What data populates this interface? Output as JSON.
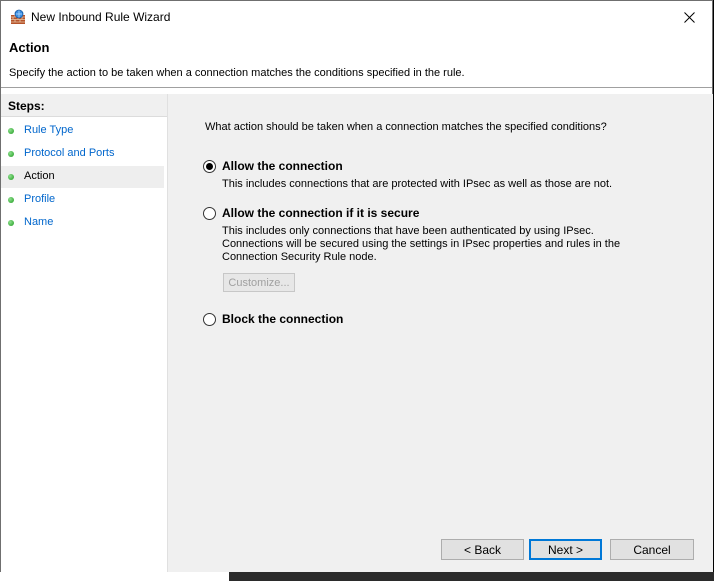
{
  "window": {
    "title": "New Inbound Rule Wizard"
  },
  "header": {
    "title": "Action",
    "description": "Specify the action to be taken when a connection matches the conditions specified in the rule."
  },
  "steps": {
    "title": "Steps:",
    "items": [
      {
        "label": "Rule Type",
        "current": false
      },
      {
        "label": "Protocol and Ports",
        "current": false
      },
      {
        "label": "Action",
        "current": true
      },
      {
        "label": "Profile",
        "current": false
      },
      {
        "label": "Name",
        "current": false
      }
    ]
  },
  "main": {
    "question": "What action should be taken when a connection matches the specified conditions?",
    "options": [
      {
        "label": "Allow the connection",
        "description": "This includes connections that are protected with IPsec as well as those are not.",
        "selected": true
      },
      {
        "label": "Allow the connection if it is secure",
        "description": "This includes only connections that have been authenticated by using IPsec.  Connections will be secured using the settings in IPsec properties and rules in the Connection Security Rule node.",
        "selected": false
      },
      {
        "label": "Block the connection",
        "description": "",
        "selected": false
      }
    ],
    "customize_label": "Customize..."
  },
  "buttons": {
    "back": "< Back",
    "next": "Next >",
    "cancel": "Cancel"
  },
  "colors": {
    "link": "#0066cc",
    "content_bg": "#f0f0f0",
    "step_dot": "#1f9b1f",
    "default_button_border": "#0078d7"
  }
}
